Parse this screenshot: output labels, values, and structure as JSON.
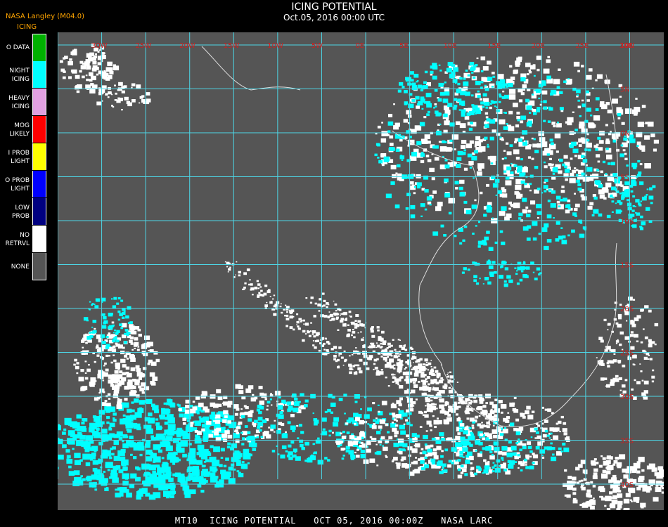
{
  "header": {
    "source": "NASA Langley (M04.0)",
    "product": "ICING",
    "title": "ICING POTENTIAL",
    "datetime": "Oct.05, 2016 00:00 UTC"
  },
  "legend": [
    {
      "label": "O DATA",
      "color": "#00b000"
    },
    {
      "label": "NIGHT\nICING",
      "color": "#00ffff"
    },
    {
      "label": "HEAVY\nICING",
      "color": "#e0a0e0"
    },
    {
      "label": "MOG\nLIKELY",
      "color": "#ff0000"
    },
    {
      "label": "I PROB\nLIGHT",
      "color": "#ffff00"
    },
    {
      "label": "O PROB\nLIGHT",
      "color": "#0000ff"
    },
    {
      "label": "LOW\nPROB",
      "color": "#000080"
    },
    {
      "label": "NO\nRETRVL",
      "color": "#ffffff"
    },
    {
      "label": "NONE",
      "color": "#555555"
    }
  ],
  "map": {
    "background_color": "#555555",
    "grid_color": "#4dd6e6",
    "label_color": "#cc2222",
    "lon_labels": [
      "30W",
      "25W",
      "20W",
      "15W",
      "10W",
      "5W",
      "0E",
      "5E",
      "10E",
      "15E",
      "20E",
      "25E",
      "30E",
      "35E"
    ],
    "lat_labels": [
      "10N",
      "5N",
      "0N",
      "5S",
      "10S",
      "15S",
      "20S",
      "25S",
      "30S",
      "35S",
      "40S"
    ]
  },
  "footer": {
    "text": "MT10  ICING POTENTIAL   OCT 05, 2016 00:00Z   NASA LARC"
  }
}
